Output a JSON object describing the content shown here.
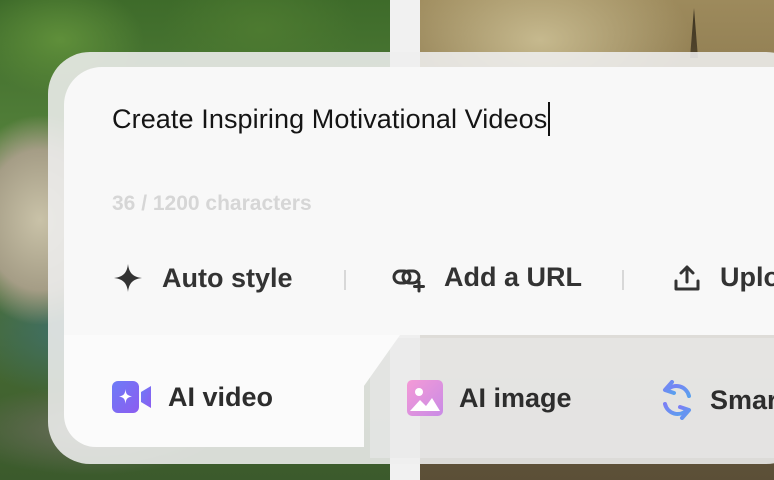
{
  "prompt": {
    "text": "Create Inspiring Motivational Videos",
    "counter": "36 / 1200 characters"
  },
  "toolbar": {
    "items": [
      {
        "label": "Auto style",
        "icon": "sparkle-icon"
      },
      {
        "label": "Add a URL",
        "icon": "link-plus-icon"
      },
      {
        "label": "Uplo",
        "icon": "upload-icon"
      }
    ]
  },
  "modes": {
    "items": [
      {
        "label": "AI video",
        "icon": "video-camera-icon",
        "color": "#7b6cf6"
      },
      {
        "label": "AI image",
        "icon": "image-icon",
        "color": "#e58ad7"
      },
      {
        "label": "Smar",
        "icon": "refresh-icon",
        "color": "#6b8cf0"
      }
    ]
  }
}
